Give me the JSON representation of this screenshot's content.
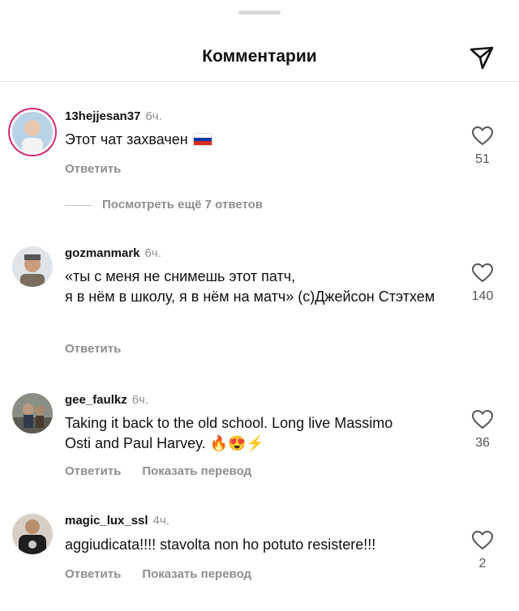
{
  "header": {
    "title": "Комментарии"
  },
  "reply_label": "Ответить",
  "translate_label": "Показать перевод",
  "view_more": "Посмотреть ещё 7 ответов",
  "comments": [
    {
      "user": "13hejjesan37",
      "time": "6ч.",
      "text": "Этот чат захвачен",
      "likes": "51"
    },
    {
      "user": "gozmanmark",
      "time": "6ч.",
      "text": "«ты с меня не снимешь этот патч,\nя в нём в школу, я в нём на матч» (с)Джейсон Стэтхем",
      "likes": "140"
    },
    {
      "user": "gee_faulkz",
      "time": "6ч.",
      "text": "Taking it back to the old school. Long live Massimo Osti and Paul Harvey. 🔥😍⚡",
      "likes": "36"
    },
    {
      "user": "magic_lux_ssl",
      "time": "4ч.",
      "text": "aggiudicata!!!! stavolta non ho potuto resistere!!!",
      "likes": "2"
    }
  ],
  "colors": {
    "secondary_text": "#8e8e8e",
    "story_ring": "#d62976"
  },
  "icons": [
    "send-icon",
    "heart-icon",
    "russia-flag-emoji"
  ]
}
